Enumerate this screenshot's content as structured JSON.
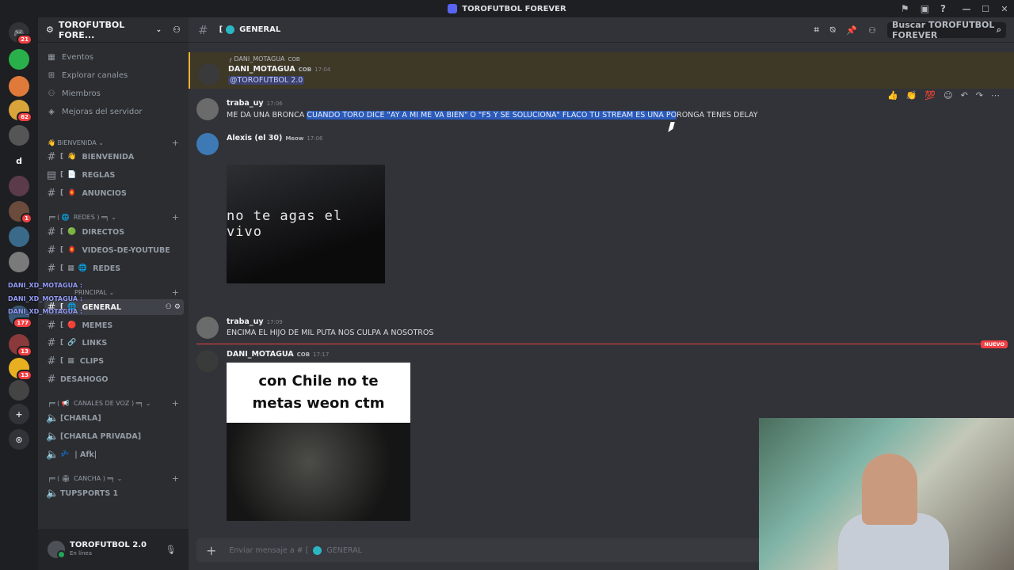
{
  "window": {
    "title": "TOROFUTBOL FOREVER"
  },
  "servers": {
    "badges": [
      "21",
      "62",
      "1",
      "177",
      "13",
      "13"
    ],
    "letter": "d"
  },
  "server": {
    "name": "TOROFUTBOL FORE..."
  },
  "nav": [
    {
      "label": "Eventos"
    },
    {
      "label": "Explorar canales"
    },
    {
      "label": "Miembros"
    },
    {
      "label": "Mejoras del servidor"
    }
  ],
  "categories": {
    "bienvenida": "BIENVENIDA",
    "redes": "REDES",
    "principal": "PRINCIPAL",
    "voz": "CANALES DE VOZ",
    "cancha": "CANCHA"
  },
  "channels": {
    "bienvenida": "BIENVENIDA",
    "reglas": "REGLAS",
    "anuncios": "ANUNCIOS",
    "directos": "DIRECTOS",
    "videos": "VIDEOS-DE-YOUTUBE",
    "redes": "REDES",
    "general": "GENERAL",
    "memes": "MEMES",
    "links": "LINKS",
    "clips": "CLIPS",
    "desahogo": "DESAHOGO",
    "charla": "[CHARLA]",
    "charla_privada": "[CHARLA PRIVADA]",
    "afk": "| Afk|",
    "tupsports": "TUPSPORTS 1"
  },
  "overlay_names": [
    "DANI_XD_MOTAGUA :",
    "DANI_XD_MOTAGUA :",
    "DANI_XD_MOTAGUA :"
  ],
  "user": {
    "name": "TOROFUTBOL 2.0",
    "status": "En línea"
  },
  "header": {
    "channel": "GENERAL",
    "search_placeholder": "Buscar TOROFUTBOL FOREVER"
  },
  "messages": [
    {
      "reply_to": "DANI_MOTAGUA",
      "reply_tag": "COB",
      "author": "DANI_MOTAGUA",
      "tag": "COB",
      "time": "17:04",
      "text": "@TOROFUTBOL 2.0"
    },
    {
      "author": "traba_uy",
      "time": "17:06",
      "text_pre": "ME DA UNA BRONCA ",
      "text_sel": "CUANDO TORO DICE \"AY A MI ME VA BIEN\" O \"F5 Y SE SOLUCIONA\" FLACO TU STREAM ES UNA PO",
      "text_post": "RONGA TENES DELAY"
    },
    {
      "author": "Alexis (el 30)",
      "tag": "Meow",
      "time": "17:06",
      "gif_caption": "no te agas el vivo"
    },
    {
      "author": "traba_uy",
      "time": "17:09",
      "text": "ENCIMA EL HIJO DE MIL PUTA NOS CULPA A NOSOTROS"
    },
    {
      "author": "DANI_MOTAGUA",
      "tag": "COB",
      "time": "17:17",
      "gif_caption": "con Chile no te metas weon ctm"
    }
  ],
  "new_label": "NUEVO",
  "composer": {
    "placeholder_prefix": "Enviar mensaje a #",
    "channel": "GENERAL"
  }
}
